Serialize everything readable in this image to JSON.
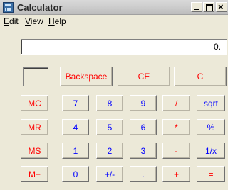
{
  "window": {
    "title": "Calculator"
  },
  "menu": {
    "edit": "Edit",
    "view": "View",
    "help": "Help"
  },
  "display": {
    "value": "0."
  },
  "buttons": {
    "backspace": "Backspace",
    "ce": "CE",
    "c": "C",
    "mc": "MC",
    "mr": "MR",
    "ms": "MS",
    "mplus": "M+",
    "n7": "7",
    "n8": "8",
    "n9": "9",
    "div": "/",
    "sqrt": "sqrt",
    "n4": "4",
    "n5": "5",
    "n6": "6",
    "mul": "*",
    "pct": "%",
    "n1": "1",
    "n2": "2",
    "n3": "3",
    "sub": "-",
    "inv": "1/x",
    "n0": "0",
    "sign": "+/-",
    "dot": ".",
    "add": "+",
    "eq": "="
  },
  "colors": {
    "function_keys": "#ff0000",
    "digit_keys": "#0000ff",
    "window_face": "#ece9d8"
  }
}
